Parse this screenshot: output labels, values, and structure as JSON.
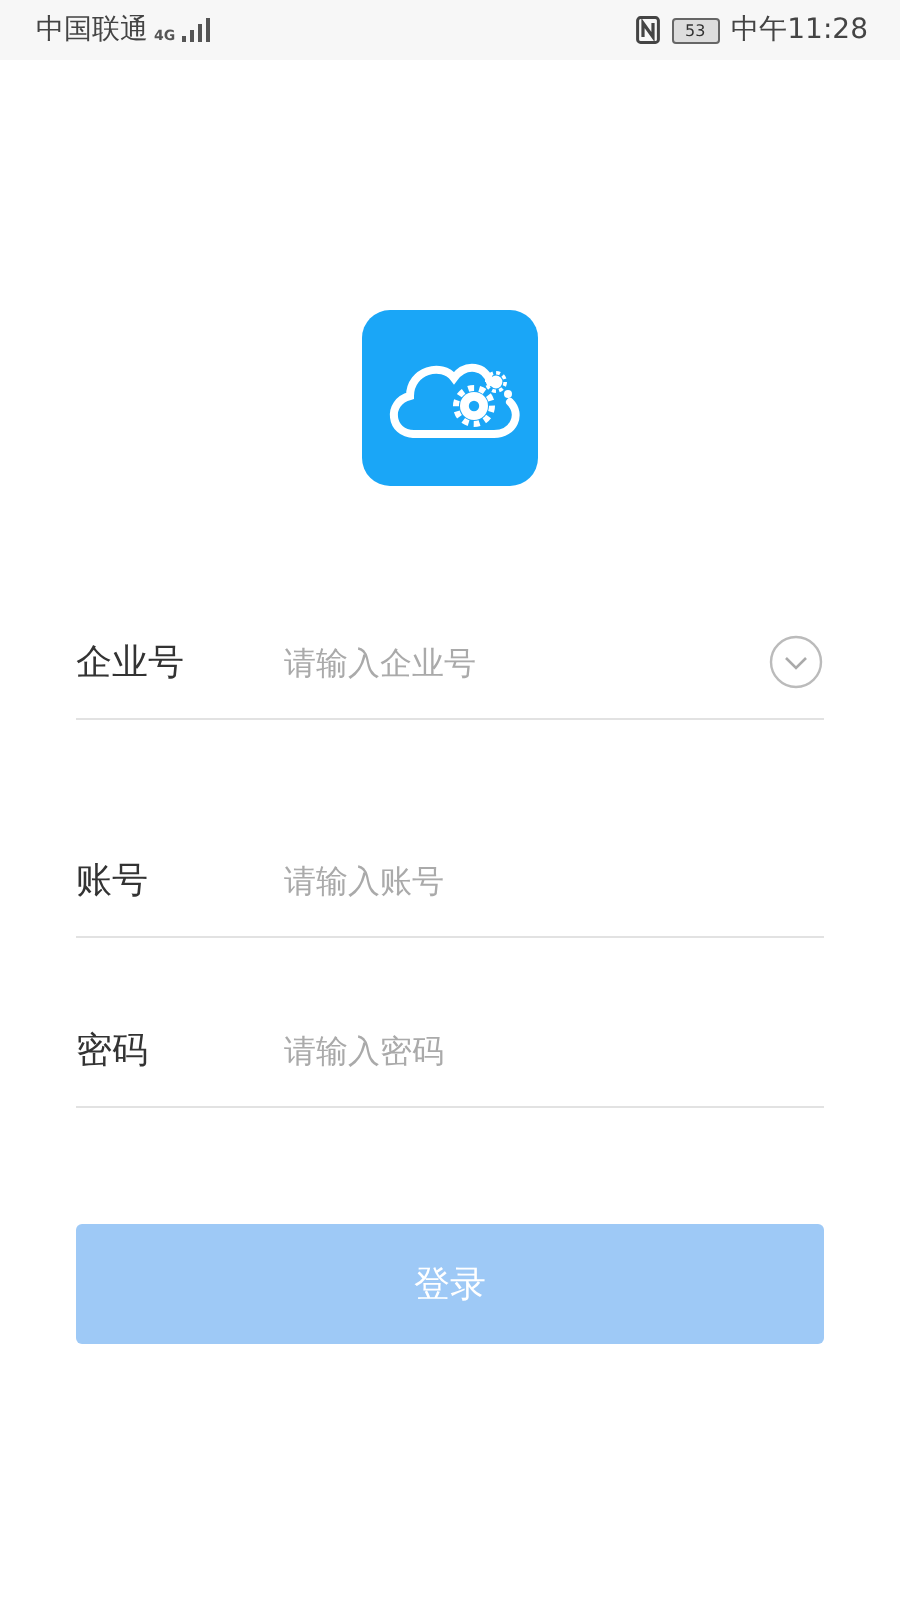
{
  "status_bar": {
    "carrier": "中国联通",
    "network": "4G",
    "battery": "53",
    "time": "中午11:28"
  },
  "fields": [
    {
      "kind": "dropdown",
      "label": "企业号",
      "placeholder": "请输入企业号"
    },
    {
      "kind": "text",
      "label": "账号",
      "placeholder": "请输入账号"
    },
    {
      "kind": "password",
      "label": "密码",
      "placeholder": "请输入密码"
    }
  ],
  "login_button": {
    "label": "登录",
    "disabled": true
  }
}
